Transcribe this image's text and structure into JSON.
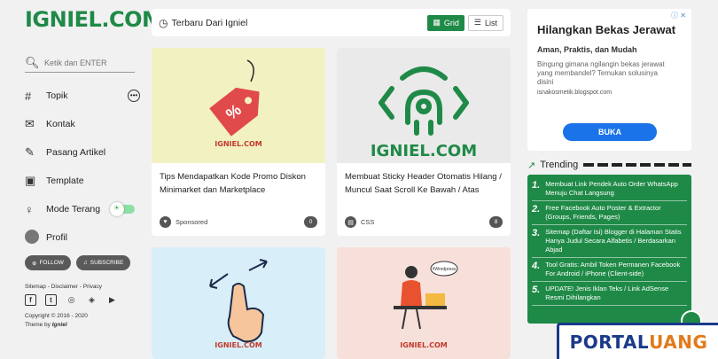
{
  "sidebar": {
    "logo": "IGNIEL.COM",
    "search_placeholder": "Ketik dan ENTER",
    "items": [
      {
        "label": "Topik"
      },
      {
        "label": "Kontak"
      },
      {
        "label": "Pasang Artikel"
      },
      {
        "label": "Template"
      },
      {
        "label": "Mode Terang"
      },
      {
        "label": "Profil"
      }
    ],
    "follow": "FOLLOW",
    "subscribe": "SUBSCRIBE",
    "footer_links": "Sitemap - Disclaimer - Privacy",
    "copyright": "Copyright © 2016 - 2020",
    "theme_by": "Theme by",
    "theme_author": "Igniel"
  },
  "header": {
    "title": "Terbaru Dari Igniel",
    "grid": "Grid",
    "list": "List"
  },
  "posts": [
    {
      "title": "Tips Mendapatkan Kode Promo Diskon Minimarket dan Marketplace",
      "label": "Sponsored",
      "comments": "0",
      "thumb_logo": "IGNIEL.COM"
    },
    {
      "title": "Membuat Sticky Header Otomatis Hilang / Muncul Saat Scroll Ke Bawah / Atas",
      "label": "CSS",
      "comments": "8",
      "thumb_logo": "IGNIEL.COM"
    },
    {
      "thumb_logo": "IGNIEL.COM"
    },
    {
      "thumb_logo": "IGNIEL.COM",
      "bubble": "#Wordpress"
    }
  ],
  "ad": {
    "title": "Hilangkan Bekas Jerawat",
    "subtitle": "Aman, Praktis, dan Mudah",
    "body": "Bingung gimana ngilangin bekas jerawat yang membandel? Temukan solusinya disini",
    "url": "isnakosmetik.blogspot.com",
    "cta": "BUKA",
    "info": "ⓘ ✕"
  },
  "trending": {
    "heading": "Trending",
    "items": [
      {
        "n": "1.",
        "text": "Membuat Link Pendek Auto Order WhatsApp Menuju Chat Langsung"
      },
      {
        "n": "2.",
        "text": "Free Facebook Auto Poster & Extractor (Groups, Friends, Pages)"
      },
      {
        "n": "3.",
        "text": "Sitemap (Daftar Isi) Blogger di Halaman Statis Hanya Judul Secara Alfabetis / Berdasarkan Abjad"
      },
      {
        "n": "4.",
        "text": "Tool Gratis: Ambil Token Permanen Facebook For Android / iPhone (Client-side)"
      },
      {
        "n": "5.",
        "text": "UPDATE! Jenis Iklan Teks / Link AdSense Resmi Dihilangkan"
      }
    ]
  },
  "watermark": {
    "part1": "PORTAL",
    "part2": "UANG"
  },
  "colors": {
    "brand": "#1f8a47",
    "ad_button": "#1a73e8"
  }
}
